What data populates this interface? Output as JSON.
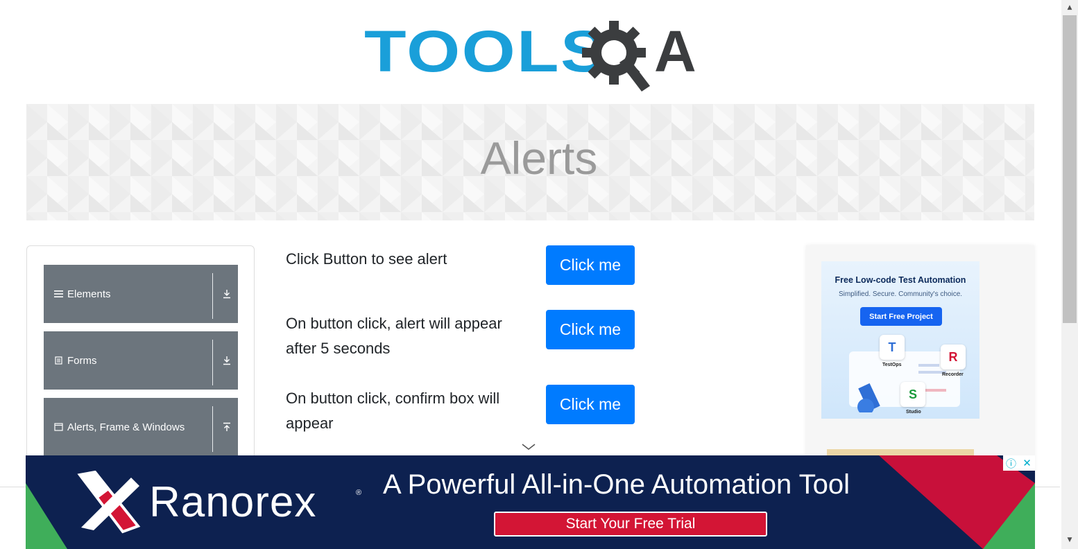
{
  "header": {
    "logo_text_left": "TOOLS",
    "logo_text_right": "A",
    "logo_icon": "gear-magnifier-icon"
  },
  "banner": {
    "title": "Alerts"
  },
  "left_menu": {
    "groups": [
      {
        "label": "Elements",
        "icon": "hamburger-icon",
        "toggle_icon": "download-arrow-icon"
      },
      {
        "label": "Forms",
        "icon": "document-icon",
        "toggle_icon": "download-arrow-icon"
      },
      {
        "label": "Alerts, Frame & Windows",
        "icon": "window-icon",
        "toggle_icon": "upload-arrow-icon"
      }
    ]
  },
  "main": {
    "rows": [
      {
        "text": "Click Button to see alert",
        "button_label": "Click me"
      },
      {
        "text": "On button click, alert will appear after 5 seconds",
        "button_label": "Click me"
      },
      {
        "text": "On button click, confirm box will appear",
        "button_label": "Click me"
      }
    ]
  },
  "side_ad": {
    "headline": "Free Low-code Test Automation",
    "subline": "Simplified. Secure. Community's choice.",
    "cta": "Start Free Project",
    "tiles": [
      {
        "letter": "T",
        "label": "TestOps"
      },
      {
        "letter": "R",
        "label": "Recorder"
      },
      {
        "letter": "S",
        "label": "Studio"
      }
    ]
  },
  "bottom_ad": {
    "brand": "Ranorex",
    "registered": "®",
    "headline": "A Powerful All-in-One Automation Tool",
    "cta": "Start Your Free Trial",
    "info_icon": "ⓘ",
    "close_icon": "✕"
  },
  "colors": {
    "primary_button": "#007bff",
    "menu_group_bg": "#6c757d",
    "logo_blue": "#1a9fd9",
    "logo_dark": "#3b3d3f",
    "ad_navy": "#0d2150",
    "ad_red": "#d31535"
  }
}
